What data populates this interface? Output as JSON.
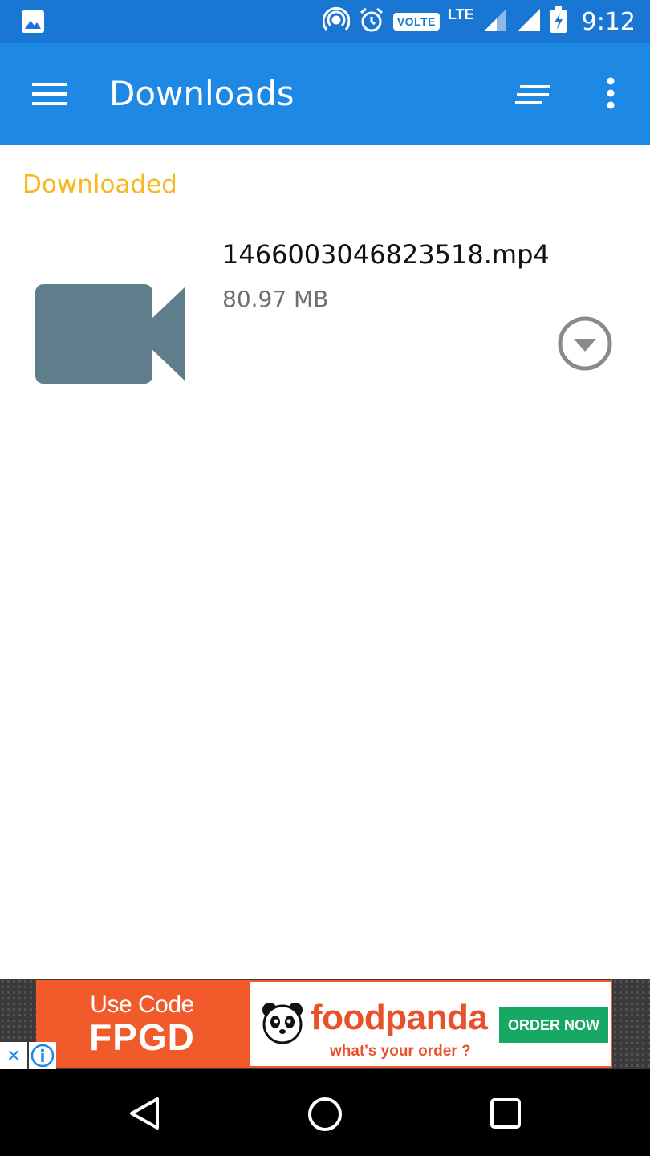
{
  "status_bar": {
    "time": "9:12",
    "volte_label": "VOLTE",
    "network_label": "LTE",
    "icons": [
      "image-notification-icon",
      "hotspot-icon",
      "alarm-icon",
      "volte-badge",
      "signal-icon",
      "signal-icon",
      "battery-charging-icon"
    ]
  },
  "app_bar": {
    "title": "Downloads",
    "icons": [
      "menu-icon",
      "sort-icon",
      "more-vert-icon"
    ]
  },
  "section": {
    "header": "Downloaded"
  },
  "files": [
    {
      "name": "1466003046823518.mp4",
      "size": "80.97 MB",
      "icon": "video-camera-icon",
      "action_icon": "dropdown-circle-icon"
    }
  ],
  "ad": {
    "promo_line1": "Use Code",
    "promo_code": "FPGD",
    "brand": "foodpanda",
    "tagline": "what's your order ?",
    "cta": "ORDER NOW",
    "close_glyph": "×"
  },
  "nav_bar": {
    "icons": [
      "back-icon",
      "home-icon",
      "recent-apps-icon"
    ]
  },
  "colors": {
    "status_bar": "#1976d2",
    "app_bar": "#1e88e5",
    "section_header": "#f5b820",
    "file_icon": "#607d8b",
    "ad_orange": "#f15a2b",
    "ad_green": "#16a864"
  }
}
